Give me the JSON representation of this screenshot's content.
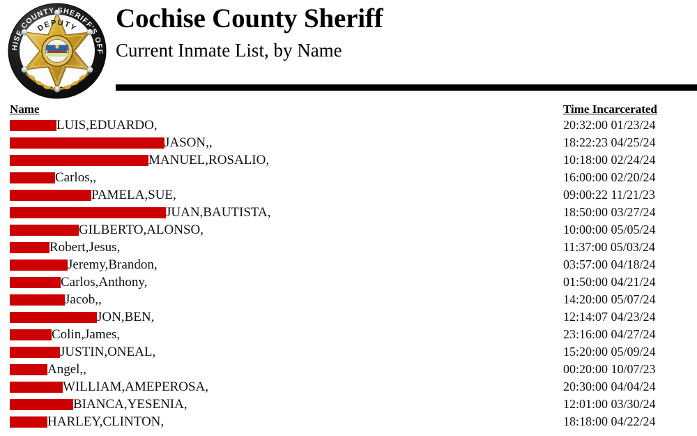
{
  "header": {
    "title": "Cochise County Sheriff",
    "subtitle": "Current Inmate List, by Name",
    "badge": {
      "icon": "sheriff-star-badge-icon",
      "outer_text_top": "COCHISE COUNTY SHERIFF'S OFFICE",
      "rank_text": "DEPUTY",
      "state_text": "ARIZONA",
      "gold": "#d4a017",
      "gold_dark": "#a87d10",
      "gold_light": "#f2d98a",
      "ring": "#1a1a1a"
    },
    "rule_color": "#000000"
  },
  "table": {
    "columns": [
      {
        "key": "name",
        "label": "Name"
      },
      {
        "key": "time",
        "label": "Time Incarcerated"
      }
    ],
    "redaction_color": "#cc0000",
    "rows": [
      {
        "redaction_width": 67,
        "name": "LUIS,EDUARDO,",
        "time": "20:32:00 01/23/24"
      },
      {
        "redaction_width": 222,
        "name": "JASON,,",
        "time": "18:22:23 04/25/24"
      },
      {
        "redaction_width": 199,
        "name": "MANUEL,ROSALIO,",
        "time": "10:18:00 02/24/24"
      },
      {
        "redaction_width": 65,
        "name": "Carlos,,",
        "time": "16:00:00 02/20/24"
      },
      {
        "redaction_width": 117,
        "name": "PAMELA,SUE,",
        "time": "09:00:22 11/21/23"
      },
      {
        "redaction_width": 224,
        "name": "JUAN,BAUTISTA,",
        "time": "18:50:00 03/27/24"
      },
      {
        "redaction_width": 99,
        "name": "GILBERTO,ALONSO,",
        "time": "10:00:00 05/05/24"
      },
      {
        "redaction_width": 57,
        "name": "Robert,Jesus,",
        "time": "11:37:00 05/03/24"
      },
      {
        "redaction_width": 83,
        "name": "Jeremy,Brandon,",
        "time": "03:57:00 04/18/24"
      },
      {
        "redaction_width": 73,
        "name": "Carlos,Anthony,",
        "time": "01:50:00 04/21/24"
      },
      {
        "redaction_width": 79,
        "name": "Jacob,,",
        "time": "14:20:00 05/07/24"
      },
      {
        "redaction_width": 125,
        "name": "JON,BEN,",
        "time": "12:14:07 04/23/24"
      },
      {
        "redaction_width": 60,
        "name": "Colin,James,",
        "time": "23:16:00 04/27/24"
      },
      {
        "redaction_width": 72,
        "name": "JUSTIN,ONEAL,",
        "time": "15:20:00 05/09/24"
      },
      {
        "redaction_width": 54,
        "name": "Angel,,",
        "time": "00:20:00 10/07/23"
      },
      {
        "redaction_width": 76,
        "name": "WILLIAM,AMEPEROSA,",
        "time": "20:30:00 04/04/24"
      },
      {
        "redaction_width": 91,
        "name": "BIANCA,YESENIA,",
        "time": "12:01:00 03/30/24"
      },
      {
        "redaction_width": 54,
        "name": "HARLEY,CLINTON,",
        "time": "18:18:00 04/22/24"
      }
    ]
  }
}
